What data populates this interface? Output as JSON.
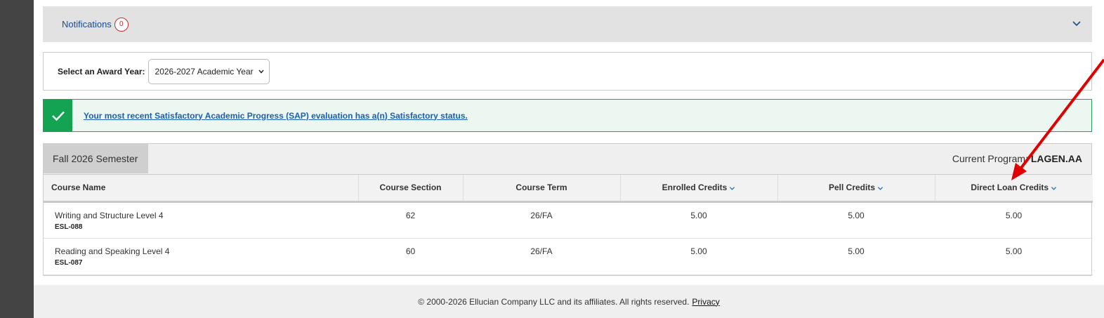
{
  "notifications": {
    "title": "Notifications",
    "count": "0"
  },
  "award_year": {
    "label": "Select an Award Year:",
    "selected": "2026-2027 Academic Year"
  },
  "sap": {
    "message": "Your most recent Satisfactory Academic Progress (SAP) evaluation has a(n) Satisfactory status."
  },
  "term": {
    "semester": "Fall 2026 Semester",
    "program_label": "Current Program:",
    "program_value": "LAGEN.AA"
  },
  "table": {
    "headers": [
      "Course Name",
      "Course Section",
      "Course Term",
      "Enrolled Credits",
      "Pell Credits",
      "Direct Loan Credits"
    ],
    "rows": [
      {
        "name": "Writing and Structure Level 4",
        "code": "ESL-088",
        "section": "62",
        "term": "26/FA",
        "enrolled": "5.00",
        "pell": "5.00",
        "direct_loan": "5.00"
      },
      {
        "name": "Reading and Speaking Level 4",
        "code": "ESL-087",
        "section": "60",
        "term": "26/FA",
        "enrolled": "5.00",
        "pell": "5.00",
        "direct_loan": "5.00"
      }
    ]
  },
  "footer": {
    "copyright": "© 2000-2026 Ellucian Company LLC and its affiliates. All rights reserved.",
    "privacy": "Privacy"
  },
  "colors": {
    "accent_blue": "#1a4b8c",
    "success_green": "#13a352",
    "badge_red": "#c42b2b",
    "arrow_red": "#e00000"
  },
  "icons": [
    "chevron-down-icon",
    "checkmark-icon",
    "sort-chevron-icon",
    "select-chevron-icon"
  ]
}
